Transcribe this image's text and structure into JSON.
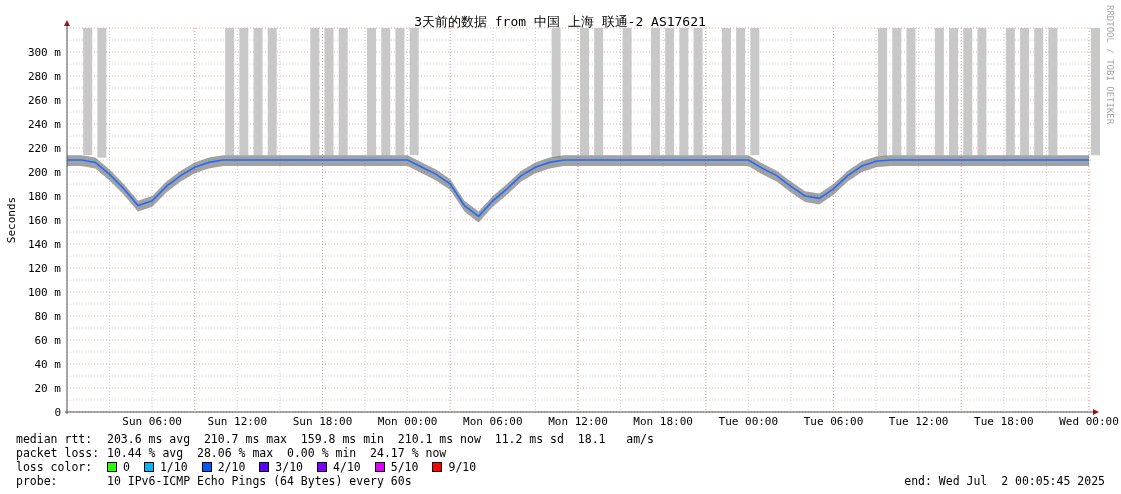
{
  "chart": {
    "chart_data": {
      "type": "line",
      "grid": true,
      "title": "3天前的数据 from 中国 上海 联通-2 AS17621",
      "ylabel": "Seconds",
      "categories": [
        null,
        null,
        null,
        null,
        null,
        null,
        "Sun 06:00",
        null,
        null,
        null,
        null,
        null,
        "Sun 12:00",
        null,
        null,
        null,
        null,
        null,
        "Sun 18:00",
        null,
        null,
        null,
        null,
        null,
        "Mon 00:00",
        null,
        null,
        null,
        null,
        null,
        "Mon 06:00",
        null,
        null,
        null,
        null,
        null,
        "Mon 12:00",
        null,
        null,
        null,
        null,
        null,
        "Mon 18:00",
        null,
        null,
        null,
        null,
        null,
        "Tue 00:00",
        null,
        null,
        null,
        null,
        null,
        "Tue 06:00",
        null,
        null,
        null,
        null,
        null,
        "Tue 12:00",
        null,
        null,
        null,
        null,
        null,
        "Tue 18:00",
        null,
        null,
        null,
        null,
        null,
        "Wed 00:00"
      ],
      "ylim": [
        0,
        320
      ],
      "yticks": [
        {
          "value": 0,
          "label": "0"
        },
        {
          "value": 20,
          "label": "20 m"
        },
        {
          "value": 40,
          "label": "40 m"
        },
        {
          "value": 60,
          "label": "60 m"
        },
        {
          "value": 80,
          "label": "80 m"
        },
        {
          "value": 100,
          "label": "100 m"
        },
        {
          "value": 120,
          "label": "120 m"
        },
        {
          "value": 140,
          "label": "140 m"
        },
        {
          "value": 160,
          "label": "160 m"
        },
        {
          "value": 180,
          "label": "180 m"
        },
        {
          "value": 200,
          "label": "200 m"
        },
        {
          "value": 220,
          "label": "220 m"
        },
        {
          "value": 240,
          "label": "240 m"
        },
        {
          "value": 260,
          "label": "260 m"
        },
        {
          "value": 280,
          "label": "280 m"
        },
        {
          "value": 300,
          "label": "300 m"
        }
      ],
      "series": [
        {
          "color": "#1e6cff",
          "values": [
            210,
            210,
            208,
            198,
            186,
            172,
            176,
            188,
            197,
            204,
            208,
            210,
            210,
            210,
            210,
            210,
            210,
            210,
            210,
            210,
            210,
            210,
            210,
            210,
            210,
            204,
            198,
            190,
            172,
            163,
            176,
            186,
            197,
            204,
            208,
            210,
            210,
            210,
            210,
            210,
            210,
            210,
            210,
            210,
            210,
            210,
            210,
            210,
            210,
            203,
            197,
            188,
            180,
            178,
            186,
            197,
            205,
            209,
            210,
            210,
            210,
            210,
            210,
            210,
            210,
            210,
            210,
            210,
            210,
            210,
            210,
            210,
            210
          ]
        }
      ]
    },
    "credit": "RRDTOOL / TOBI OETIKER"
  },
  "legend": {
    "stats": [
      {
        "label": "median rtt:",
        "text": "203.6 ms avg  210.7 ms max  159.8 ms min  210.1 ms now  11.2 ms sd  18.1   am/s"
      },
      {
        "label": "packet loss:",
        "text": "10.44 % avg  28.06 % max  0.00 % min  24.17 % now"
      }
    ],
    "loss_color": {
      "label": "loss color:",
      "items": [
        {
          "label": "0",
          "color": "#26ff00"
        },
        {
          "label": "1/10",
          "color": "#00b8ff"
        },
        {
          "label": "2/10",
          "color": "#0059ff"
        },
        {
          "label": "3/10",
          "color": "#5e00ff"
        },
        {
          "label": "4/10",
          "color": "#7e00ff"
        },
        {
          "label": "5/10",
          "color": "#dd00ff"
        },
        {
          "label": "9/10",
          "color": "#ff0000"
        }
      ]
    },
    "probe": {
      "label": "probe:",
      "text": "10 IPv6-ICMP Echo Pings (64 Bytes) every 60s"
    },
    "end": "end: Wed Jul  2 00:05:45 2025"
  }
}
